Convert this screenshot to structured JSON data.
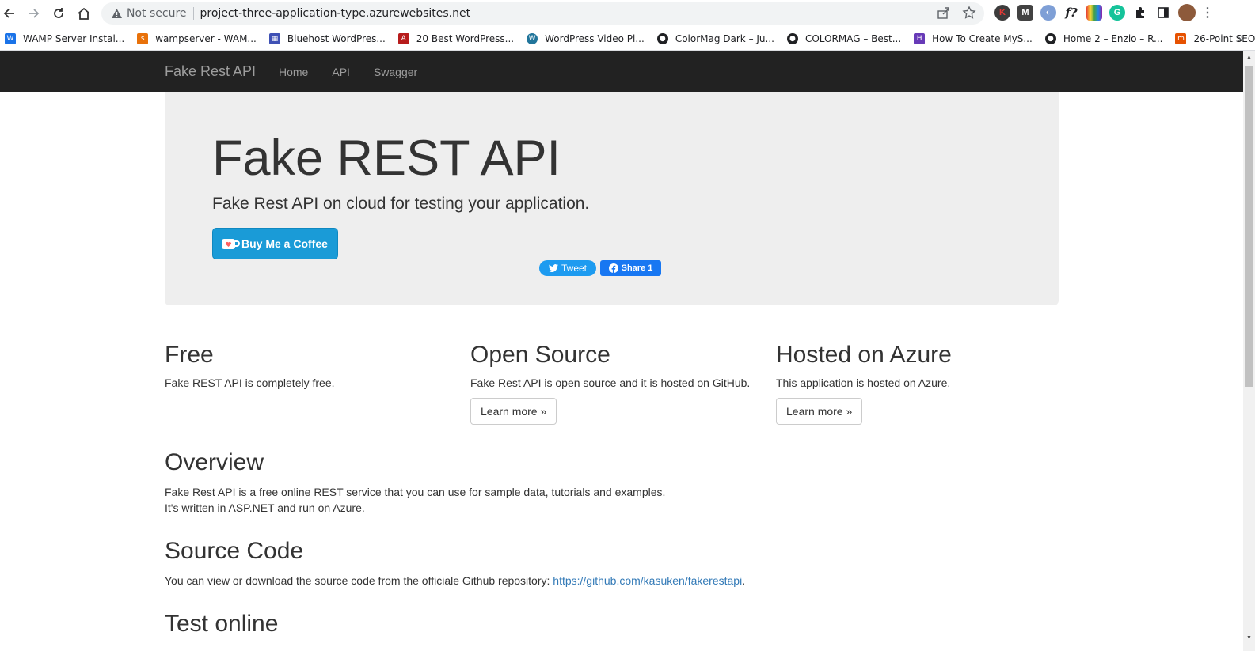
{
  "browser": {
    "security_label": "Not secure",
    "url": "project-three-application-type.azurewebsites.net",
    "bookmarks": [
      {
        "label": "WAMP Server Instal...",
        "color": "#1a73e8"
      },
      {
        "label": "wampserver - WAM...",
        "color": "#e8710a"
      },
      {
        "label": "Bluehost WordPres...",
        "color": "#3f51b5"
      },
      {
        "label": "20 Best WordPress...",
        "color": "#b71c1c"
      },
      {
        "label": "WordPress Video Pl...",
        "color": "#21759b"
      },
      {
        "label": "ColorMag Dark – Ju...",
        "color": "#202124"
      },
      {
        "label": "COLORMAG – Best...",
        "color": "#202124"
      },
      {
        "label": "How To Create MyS...",
        "color": "#673ab7"
      },
      {
        "label": "Home 2 – Enzio – R...",
        "color": "#202124"
      },
      {
        "label": "26-Point SEO Check...",
        "color": "#e65100"
      }
    ],
    "bookmarks_more": "»"
  },
  "navbar": {
    "brand": "Fake Rest API",
    "links": [
      "Home",
      "API",
      "Swagger"
    ]
  },
  "jumbotron": {
    "title": "Fake REST API",
    "lead": "Fake Rest API on cloud for testing your application.",
    "coffee_button": "Buy Me a Coffee",
    "tweet_button": "Tweet",
    "share_button": "Share 1"
  },
  "features": [
    {
      "title": "Free",
      "text": "Fake REST API is completely free.",
      "button": ""
    },
    {
      "title": "Open Source",
      "text": "Fake Rest API is open source and it is hosted on GitHub.",
      "button": "Learn more »"
    },
    {
      "title": "Hosted on Azure",
      "text": "This application is hosted on Azure.",
      "button": "Learn more »"
    }
  ],
  "overview": {
    "title": "Overview",
    "line1": "Fake Rest API is a free online REST service that you can use for sample data, tutorials and examples.",
    "line2": "It's written in ASP.NET and run on Azure."
  },
  "source_code": {
    "title": "Source Code",
    "text": "You can view or download the source code from the officiale Github repository: ",
    "link": "https://github.com/kasuken/fakerestapi",
    "trailing": "."
  },
  "test_online": {
    "title": "Test online"
  },
  "colors": {
    "navbar_bg": "#222222",
    "jumbotron_bg": "#eeeeee",
    "coffee_blue": "#1a9bd7",
    "link": "#337ab7"
  }
}
